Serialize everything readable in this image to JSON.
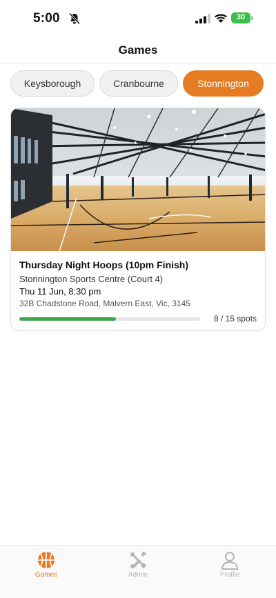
{
  "status_bar": {
    "time": "5:00",
    "battery": "30"
  },
  "header": {
    "title": "Games"
  },
  "locations": [
    {
      "label": "Keysborough",
      "active": false
    },
    {
      "label": "Cranbourne",
      "active": false
    },
    {
      "label": "Stonnington",
      "active": true
    }
  ],
  "game": {
    "title": "Thursday Night Hoops (10pm Finish)",
    "venue": "Stonnington Sports Centre (Court 4)",
    "datetime": "Thu 11 Jun, 8:30 pm",
    "address": "32B Chadstone Road, Malvern East, Vic, 3145",
    "spots_label": "8 / 15 spots",
    "filled": 8,
    "capacity": 15
  },
  "nav": {
    "games_label": "Games",
    "admin_label": "Admin",
    "profile_label": "Profile",
    "active": "games"
  },
  "colors": {
    "accent": "#e57c22",
    "progress": "#3da74b",
    "battery": "#3ac04a"
  }
}
